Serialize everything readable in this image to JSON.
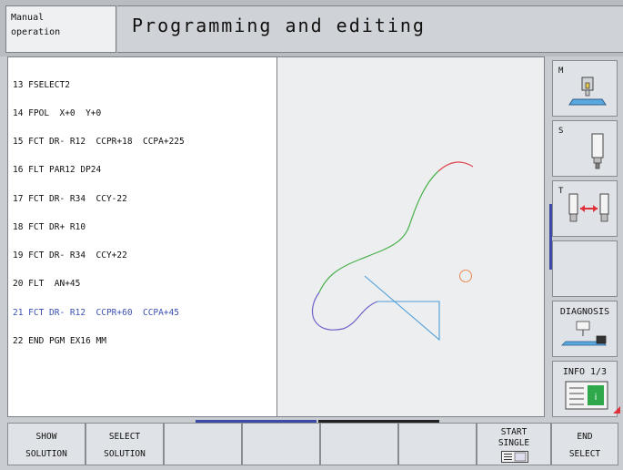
{
  "header": {
    "mode_line1": "Manual",
    "mode_line2": "operation",
    "title": "Programming and editing"
  },
  "program": {
    "lines": [
      "13 FSELECT2",
      "14 FPOL  X+0  Y+0",
      "15 FCT DR- R12  CCPR+18  CCPA+225",
      "16 FLT PAR12 DP24",
      "17 FCT DR- R34  CCY-22",
      "18 FCT DR+ R10",
      "19 FCT DR- R34  CCY+22",
      "20 FLT  AN+45",
      "21 FCT DR- R12  CCPR+60  CCPA+45",
      "22 END PGM EX16 MM"
    ],
    "active_line": "21 FCT DR- R12  CCPR+60  CCPA+45"
  },
  "right_softkeys": {
    "m": "M",
    "s": "S",
    "t": "T",
    "diagnosis": "DIAGNOSIS",
    "info": "INFO 1/3"
  },
  "bottom_softkeys": {
    "show_1": "SHOW",
    "show_2": "SOLUTION",
    "select_1": "SELECT",
    "select_2": "SOLUTION",
    "start_1": "START",
    "start_2": "SINGLE",
    "end_1": "END",
    "end_2": "SELECT"
  },
  "icons": {
    "m": "machine-table-icon",
    "s": "spindle-tool-icon",
    "t": "tool-change-icon",
    "diagnosis": "diagnosis-icon",
    "info": "info-icon",
    "start": "single-block-icon"
  },
  "colors": {
    "active_line": "#3b4fb0",
    "contour_red": "#e0414a",
    "contour_green": "#4ab04a",
    "contour_purple": "#6b5fc8",
    "contour_cyan": "#4f9fd8",
    "circle_orange": "#e8905a",
    "tool_arrow": "#e0303a",
    "info_green": "#2ea84a"
  }
}
